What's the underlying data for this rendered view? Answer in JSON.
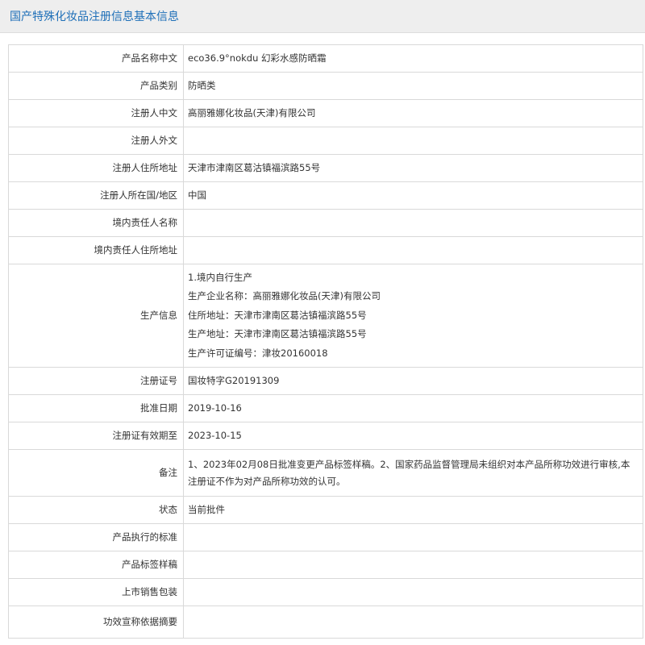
{
  "header": {
    "title": "国产特殊化妆品注册信息基本信息"
  },
  "rows": {
    "product_name_cn": {
      "label": "产品名称中文",
      "value": "eco36.9°nokdu 幻彩水感防晒霜"
    },
    "product_category": {
      "label": "产品类别",
      "value": "防晒类"
    },
    "registrant_cn": {
      "label": "注册人中文",
      "value": "高丽雅娜化妆品(天津)有限公司"
    },
    "registrant_foreign": {
      "label": "注册人外文",
      "value": ""
    },
    "registrant_address": {
      "label": "注册人住所地址",
      "value": "天津市津南区葛沽镇福滨路55号"
    },
    "registrant_country": {
      "label": "注册人所在国/地区",
      "value": "中国"
    },
    "domestic_agent_name": {
      "label": "境内责任人名称",
      "value": ""
    },
    "domestic_agent_address": {
      "label": "境内责任人住所地址",
      "value": ""
    },
    "production_info": {
      "label": "生产信息",
      "lines": [
        "1.境内自行生产",
        "生产企业名称：高丽雅娜化妆品(天津)有限公司",
        "住所地址：天津市津南区葛沽镇福滨路55号",
        "生产地址：天津市津南区葛沽镇福滨路55号",
        "生产许可证编号：津妆20160018"
      ]
    },
    "registration_no": {
      "label": "注册证号",
      "value": "国妆特字G20191309"
    },
    "approval_date": {
      "label": "批准日期",
      "value": "2019-10-16"
    },
    "valid_until": {
      "label": "注册证有效期至",
      "value": "2023-10-15"
    },
    "remarks": {
      "label": "备注",
      "value": "1、2023年02月08日批准变更产品标签样稿。2、国家药品监督管理局未组织对本产品所称功效进行审核,本注册证不作为对产品所称功效的认可。"
    },
    "status": {
      "label": "状态",
      "value": "当前批件"
    },
    "product_standard": {
      "label": "产品执行的标准",
      "value": ""
    },
    "label_draft": {
      "label": "产品标签样稿",
      "value": ""
    },
    "retail_packaging": {
      "label": "上市销售包装",
      "value": ""
    },
    "efficacy_summary": {
      "label": "功效宣称依据摘要",
      "value": ""
    }
  }
}
